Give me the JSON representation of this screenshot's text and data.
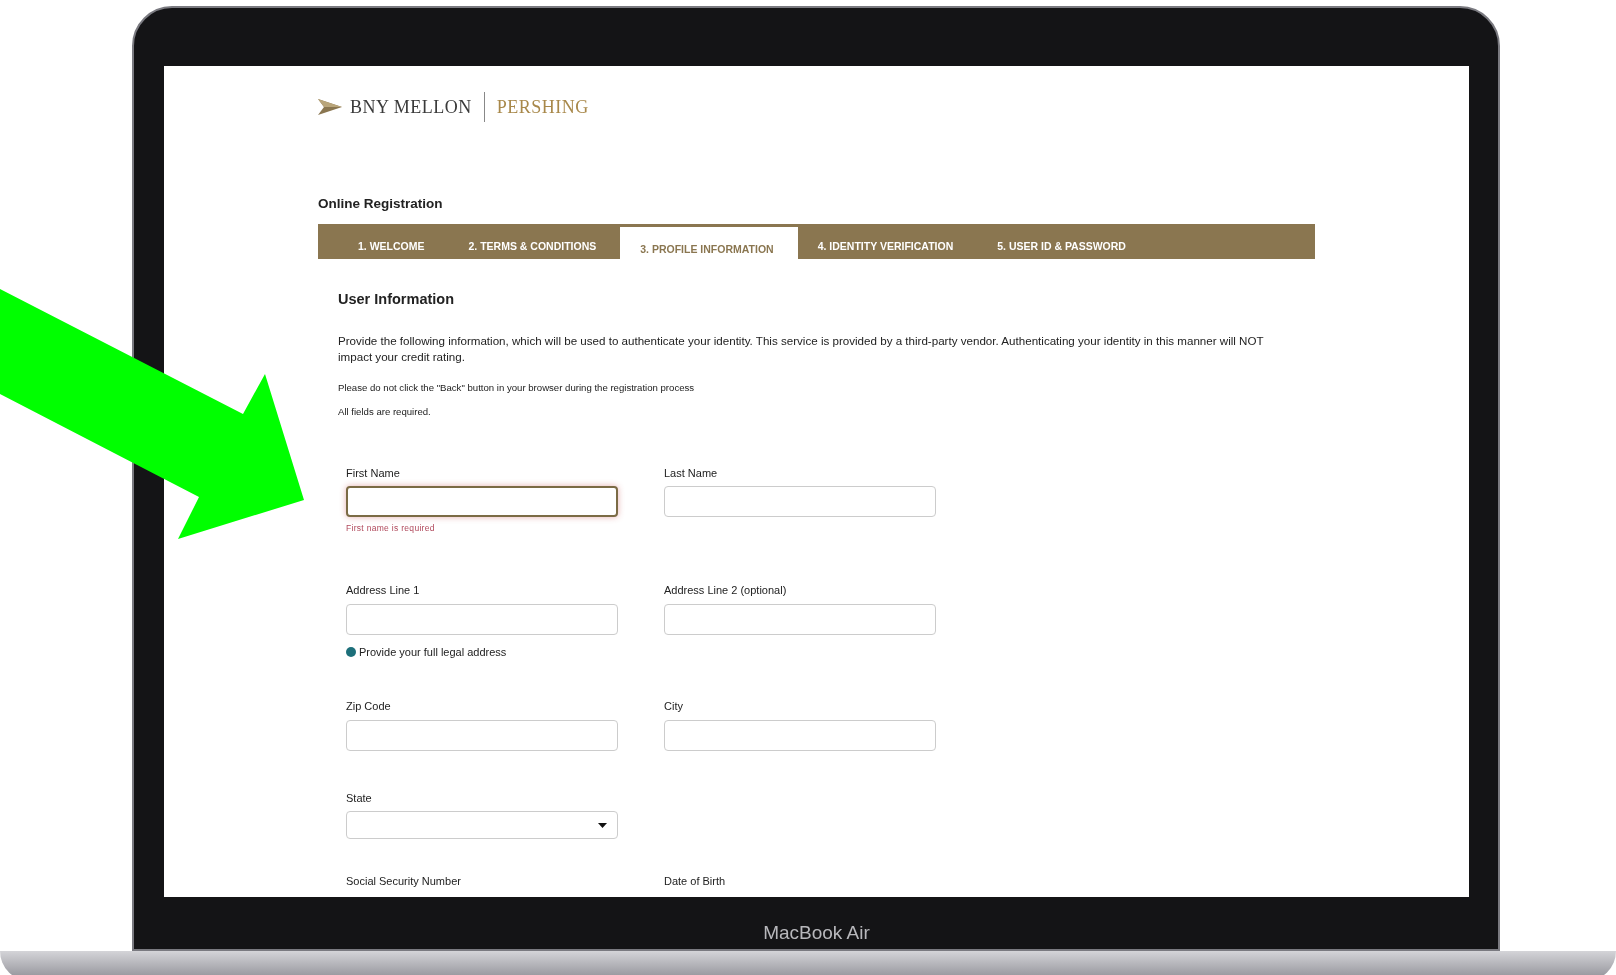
{
  "logo": {
    "primary": "BNY MELLON",
    "secondary": "PERSHING"
  },
  "page_title": "Online Registration",
  "steps": [
    {
      "label": "1. WELCOME",
      "selected": false
    },
    {
      "label": "2. TERMS & CONDITIONS",
      "selected": false
    },
    {
      "label": "3. PROFILE INFORMATION",
      "selected": true
    },
    {
      "label": "4. IDENTITY VERIFICATION",
      "selected": false
    },
    {
      "label": "5. USER ID & PASSWORD",
      "selected": false
    }
  ],
  "section": {
    "title": "User Information",
    "intro": "Provide the following information, which will be used to authenticate your identity. This service is provided by a third-party vendor. Authenticating your identity in this manner will NOT impact your credit rating.",
    "notes": [
      "Please do not click the \"Back\" button in your browser during the registration process",
      "All fields are required."
    ]
  },
  "form_rows": [
    {
      "fields": [
        {
          "kind": "text",
          "label": "First Name",
          "invalid": true,
          "error": "First name is required"
        },
        {
          "kind": "text",
          "label": "Last Name",
          "invalid": false
        }
      ]
    },
    {
      "fields": [
        {
          "kind": "text",
          "label": "Address Line 1",
          "invalid": false,
          "help": "Provide your full legal address"
        },
        {
          "kind": "text",
          "label": "Address Line 2 (optional)",
          "invalid": false
        }
      ]
    },
    {
      "fields": [
        {
          "kind": "text",
          "label": "Zip Code",
          "invalid": false
        },
        {
          "kind": "text",
          "label": "City",
          "invalid": false
        }
      ]
    },
    {
      "fields": [
        {
          "kind": "select",
          "label": "State",
          "invalid": false
        }
      ]
    },
    {
      "fields": [
        {
          "kind": "label_only",
          "label": "Social Security Number"
        },
        {
          "kind": "label_only",
          "label": "Date of Birth"
        }
      ]
    }
  ],
  "device": {
    "label": "MacBook Air"
  }
}
